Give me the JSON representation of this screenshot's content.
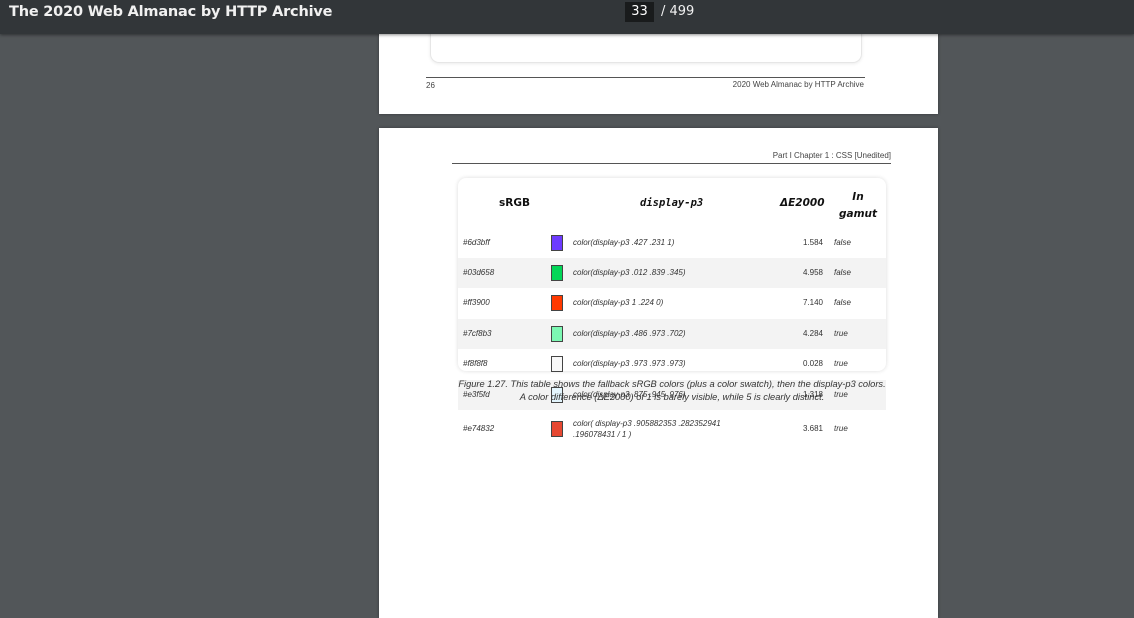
{
  "toolbar": {
    "title": "The 2020 Web Almanac by HTTP Archive",
    "current_page": "33",
    "total_pages": "/ 499"
  },
  "prev_page": {
    "page_number": "26",
    "footer_title": "2020 Web Almanac by HTTP Archive"
  },
  "current_page": {
    "header": "Part I Chapter 1 : CSS [Unedited]",
    "table": {
      "headers": {
        "srgb": "sRGB",
        "p3": "display-p3",
        "delta": "ΔE2000",
        "gamut_line1": "In",
        "gamut_line2": "gamut"
      },
      "rows": [
        {
          "hex": "#6d3bff",
          "swatch": "#6d3bff",
          "p3": "color(display-p3 .427 .231 1)",
          "delta": "1.584",
          "in_gamut": "false"
        },
        {
          "hex": "#03d658",
          "swatch": "#03d658",
          "p3": "color(display-p3 .012 .839 .345)",
          "delta": "4.958",
          "in_gamut": "false"
        },
        {
          "hex": "#ff3900",
          "swatch": "#ff3900",
          "p3": "color(display-p3 1 .224 0)",
          "delta": "7.140",
          "in_gamut": "false"
        },
        {
          "hex": "#7cf8b3",
          "swatch": "#7cf8b3",
          "p3": "color(display-p3 .486 .973 .702)",
          "delta": "4.284",
          "in_gamut": "true"
        },
        {
          "hex": "#f8f8f8",
          "swatch": "#f8f8f8",
          "p3": "color(display-p3 .973 .973 .973)",
          "delta": "0.028",
          "in_gamut": "true"
        },
        {
          "hex": "#e3f5fd",
          "swatch": "#e3f5fd",
          "p3": "color(display-p3 .875 .945 .976)",
          "delta": "1.318",
          "in_gamut": "true"
        },
        {
          "hex": "#e74832",
          "swatch": "#e74832",
          "p3_line1": "color( display-p3 .905882353 .282352941",
          "p3_line2": ".196078431 / 1 )",
          "delta": "3.681",
          "in_gamut": "true"
        }
      ]
    },
    "caption": "Figure 1.27. This table shows the fallback sRGB colors (plus a color swatch), then the display-p3 colors. A color difference (ΔE2000) of 1 is barely visible, while 5 is clearly distinct."
  }
}
